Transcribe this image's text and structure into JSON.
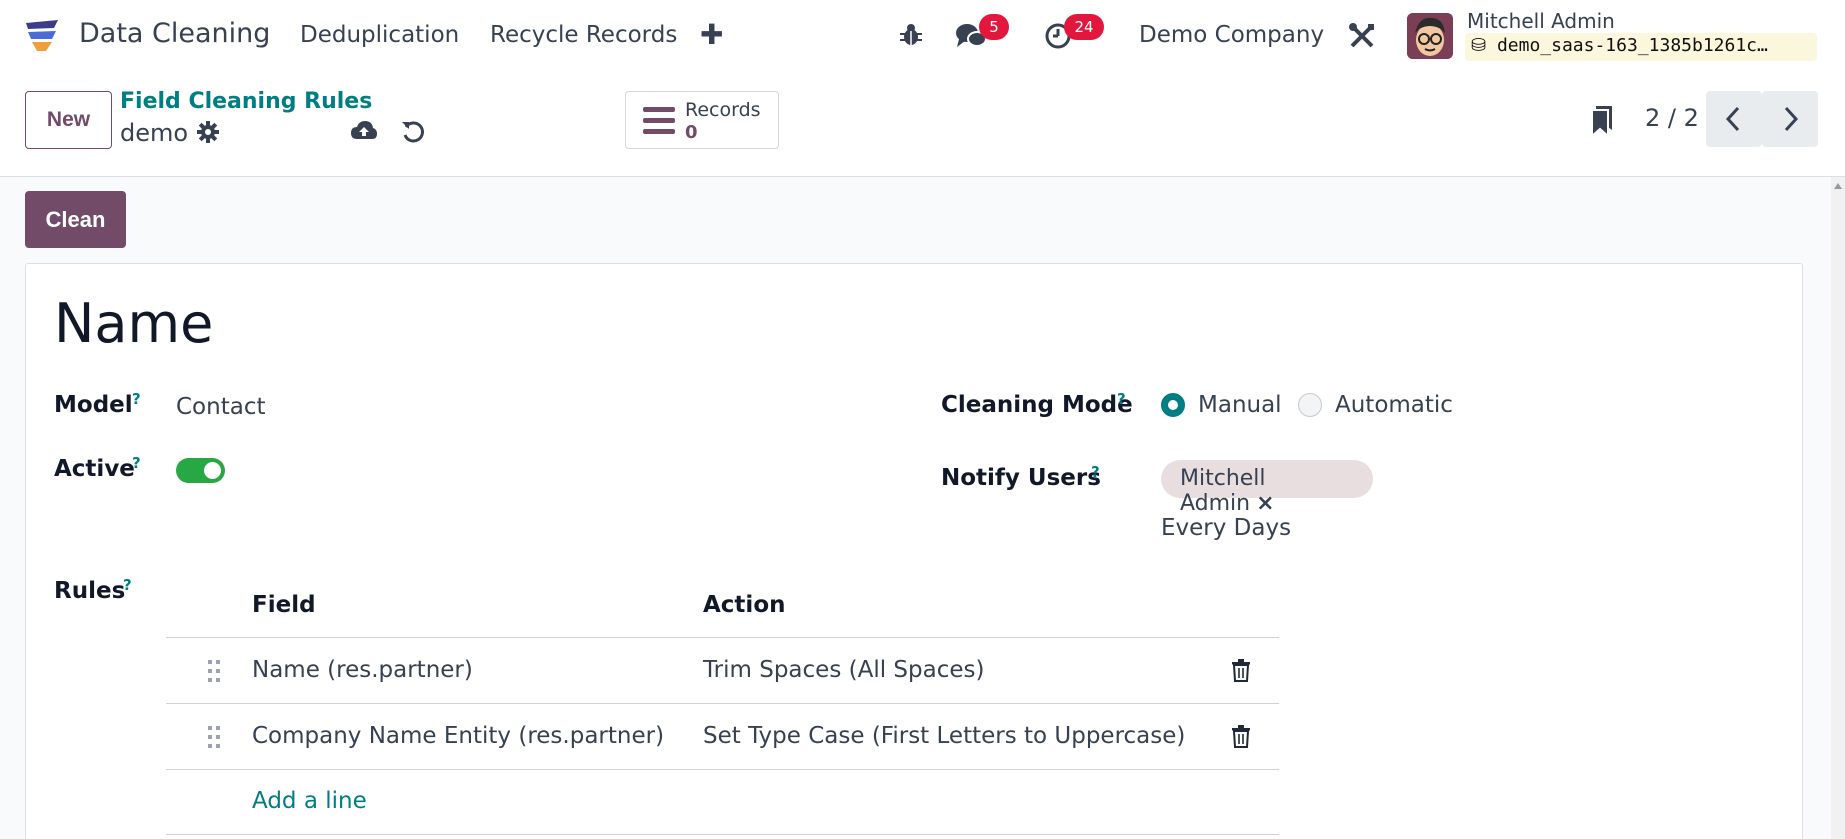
{
  "navbar": {
    "app_name": "Data Cleaning",
    "menu": [
      "Deduplication",
      "Recycle Records"
    ],
    "plus_icon": "plus-icon",
    "messages_badge": "5",
    "activities_badge": "24",
    "company": "Demo Company",
    "user_name": "Mitchell Admin",
    "database": "demo_saas-163_1385b1261c…"
  },
  "control": {
    "new_label": "New",
    "breadcrumb": "Field Cleaning Rules",
    "record_name": "demo",
    "smart_button": {
      "label": "Records",
      "value": "0"
    },
    "pager": "2 / 2"
  },
  "form": {
    "clean_label": "Clean",
    "title": "Name",
    "model_label": "Model",
    "model_value": "Contact",
    "active_label": "Active",
    "active": true,
    "cleaning_mode_label": "Cleaning Mode",
    "mode_manual": "Manual",
    "mode_automatic": "Automatic",
    "notify_label": "Notify Users",
    "notify_user": "Mitchell Admin",
    "frequency": "Every Days",
    "rules_label": "Rules",
    "help": "?",
    "columns": [
      "Field",
      "Action"
    ],
    "rows": [
      {
        "field": "Name (res.partner)",
        "action": "Trim Spaces (All Spaces)"
      },
      {
        "field": "Company Name Entity (res.partner)",
        "action": "Set Type Case (First Letters to Uppercase)"
      }
    ],
    "add_line": "Add a line"
  },
  "colors": {
    "primary": "#714b67",
    "accent": "#017e84",
    "badge": "#e3173e",
    "toggle": "#28a745"
  }
}
